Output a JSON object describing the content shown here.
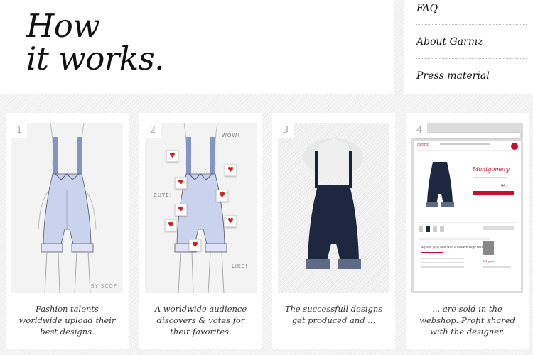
{
  "hero": {
    "line1": "How",
    "line2": "it works."
  },
  "links": [
    {
      "label": "FAQ"
    },
    {
      "label": "About Garmz"
    },
    {
      "label": "Press material"
    }
  ],
  "steps": [
    {
      "number": "1",
      "caption": "Fashion talents worldwide upload their best designs.",
      "signature": "BY SCOP"
    },
    {
      "number": "2",
      "caption": "A worldwide audience discovers & votes for their favorites.",
      "words": [
        "WOW!",
        "CUTE!",
        "LIKE!"
      ]
    },
    {
      "number": "3",
      "caption": "The successfull designs get produced and ..."
    },
    {
      "number": "4",
      "caption": "... are sold in the webshop. Profit shared with the designer.",
      "shop": {
        "brand": "garmz",
        "product": "Montgomery",
        "price": "64,-",
        "quote": "A fresh girly look with a modern edge to it.",
        "designer": "dol gasol"
      }
    }
  ],
  "colors": {
    "heart": "#cc2222",
    "shop_accent": "#c8102e",
    "garment_sketch": "#c9d3ee",
    "garment_photo": "#1e2740"
  },
  "icons": [
    "heart-icon"
  ]
}
